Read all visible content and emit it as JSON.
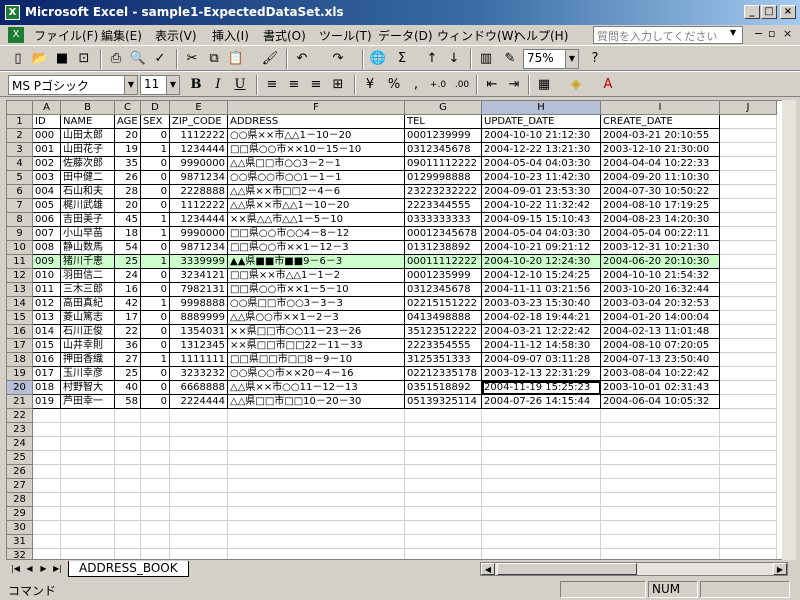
{
  "window": {
    "title": "Microsoft Excel - sample1-ExpectedDataSet.xls",
    "min": "_",
    "max": "□",
    "close": "×"
  },
  "menu": {
    "items": [
      "ファイル(F)",
      "編集(E)",
      "表示(V)",
      "挿入(I)",
      "書式(O)",
      "ツール(T)",
      "データ(D)",
      "ウィンドウ(W)",
      "ヘルプ(H)"
    ],
    "question_placeholder": "質問を入力してください"
  },
  "toolbar": {
    "zoom": "75%",
    "font": "MS Pゴシック",
    "size": "11",
    "bold": "B",
    "italic": "I",
    "underline": "U",
    "percent": "%",
    "comma": ",",
    "sum": "Σ"
  },
  "sheet": {
    "columns": [
      "A",
      "B",
      "C",
      "D",
      "E",
      "F",
      "G",
      "H",
      "I",
      "J"
    ],
    "rows": [
      [
        "ID",
        "NAME",
        "AGE",
        "SEX",
        "ZIP_CODE",
        "ADDRESS",
        "TEL",
        "UPDATE_DATE",
        "CREATE_DATE"
      ],
      [
        "000",
        "山田太郎",
        "20",
        "0",
        "1112222",
        "○○県××市△△1－10－20",
        "0001239999",
        "2004-10-10 21:12:30",
        "2004-03-21 20:10:55"
      ],
      [
        "001",
        "山田花子",
        "19",
        "1",
        "1234444",
        "□□県○○市××10－15－10",
        "0312345678",
        "2004-12-22 13:21:30",
        "2003-12-10 21:30:00"
      ],
      [
        "002",
        "佐藤次郎",
        "35",
        "0",
        "9990000",
        "△△県□□市○○3－2－1",
        "09011112222",
        "2004-05-04 04:03:30",
        "2004-04-04 10:22:33"
      ],
      [
        "003",
        "田中健二",
        "26",
        "0",
        "9871234",
        "○○県○○市○○1－1－1",
        "0129998888",
        "2004-10-23 11:42:30",
        "2004-09-20 11:10:30"
      ],
      [
        "004",
        "石山和夫",
        "28",
        "0",
        "2228888",
        "△△県××市□□2－4－6",
        "23223232222",
        "2004-09-01 23:53:30",
        "2004-07-30 10:50:22"
      ],
      [
        "005",
        "梶川武雄",
        "20",
        "0",
        "1112222",
        "△△県××市△△1－10－20",
        "2223344555",
        "2004-10-22 11:32:42",
        "2004-08-10 17:19:25"
      ],
      [
        "006",
        "吉田美子",
        "45",
        "1",
        "1234444",
        "××県△△市△△1－5－10",
        "0333333333",
        "2004-09-15 15:10:43",
        "2004-08-23 14:20:30"
      ],
      [
        "007",
        "小山早苗",
        "18",
        "1",
        "9990000",
        "□□県○○市○○4－8－12",
        "00012345678",
        "2004-05-04 04:03:30",
        "2004-05-04 00:22:11"
      ],
      [
        "008",
        "静山数馬",
        "54",
        "0",
        "9871234",
        "□□県○○市××1－12－3",
        "0131238892",
        "2004-10-21 09:21:12",
        "2003-12-31 10:21:30"
      ],
      [
        "009",
        "猪川千恵",
        "25",
        "1",
        "3339999",
        "▲▲県■■市■■9－6－3",
        "00011112222",
        "2004-10-20 12:24:30",
        "2004-06-20 20:10:30"
      ],
      [
        "010",
        "羽田信二",
        "24",
        "0",
        "3234121",
        "□□県××市△△1－1－2",
        "0001235999",
        "2004-12-10 15:24:25",
        "2004-10-10 21:54:32"
      ],
      [
        "011",
        "三木三郎",
        "16",
        "0",
        "7982131",
        "□□県○○市××1－5－10",
        "0312345678",
        "2004-11-11 03:21:56",
        "2003-10-20 16:32:44"
      ],
      [
        "012",
        "高田真紀",
        "42",
        "1",
        "9998888",
        "○○県□□市○○3－3－3",
        "02215151222",
        "2003-03-23 15:30:40",
        "2003-03-04 20:32:53"
      ],
      [
        "013",
        "菱山篤志",
        "17",
        "0",
        "8889999",
        "△△県○○市××1－2－3",
        "0413498888",
        "2004-02-18 19:44:21",
        "2004-01-20 14:00:04"
      ],
      [
        "014",
        "石川正俊",
        "22",
        "0",
        "1354031",
        "××県□□市○○11－23－26",
        "35123512222",
        "2004-03-21 12:22:42",
        "2004-02-13 11:01:48"
      ],
      [
        "015",
        "山井幸則",
        "36",
        "0",
        "1312345",
        "××県□□市□□22－11－33",
        "2223354555",
        "2004-11-12 14:58:30",
        "2004-08-10 07:20:05"
      ],
      [
        "016",
        "押田香織",
        "27",
        "1",
        "1111111",
        "□□県□□市□□8－9－10",
        "3125351333",
        "2004-09-07 03:11:28",
        "2004-07-13 23:50:40"
      ],
      [
        "017",
        "玉川幸彦",
        "25",
        "0",
        "3233232",
        "○○県○○市××20－4－16",
        "02212335178",
        "2003-12-13 22:31:29",
        "2003-08-04 10:22:42"
      ],
      [
        "018",
        "村野智大",
        "40",
        "0",
        "6668888",
        "△△県××市○○11－12－13",
        "0351518892",
        "2004-11-19 15:25:23",
        "2003-10-01 02:31:43"
      ],
      [
        "019",
        "芦田幸一",
        "58",
        "0",
        "2224444",
        "△△県□□市□□10－20－30",
        "05139325114",
        "2004-07-26 14:15:44",
        "2004-06-04 10:05:32"
      ]
    ],
    "row_numbers": [
      "1",
      "2",
      "3",
      "4",
      "5",
      "6",
      "7",
      "8",
      "9",
      "10",
      "11",
      "12",
      "13",
      "14",
      "15",
      "16",
      "17",
      "18",
      "19",
      "20",
      "21",
      "22",
      "23",
      "24",
      "25",
      "26",
      "27",
      "28",
      "29",
      "30",
      "31",
      "32",
      "33"
    ]
  },
  "tabs": {
    "sheet_name": "ADDRESS_BOOK"
  },
  "status": {
    "mode": "コマンド",
    "num": "NUM"
  }
}
